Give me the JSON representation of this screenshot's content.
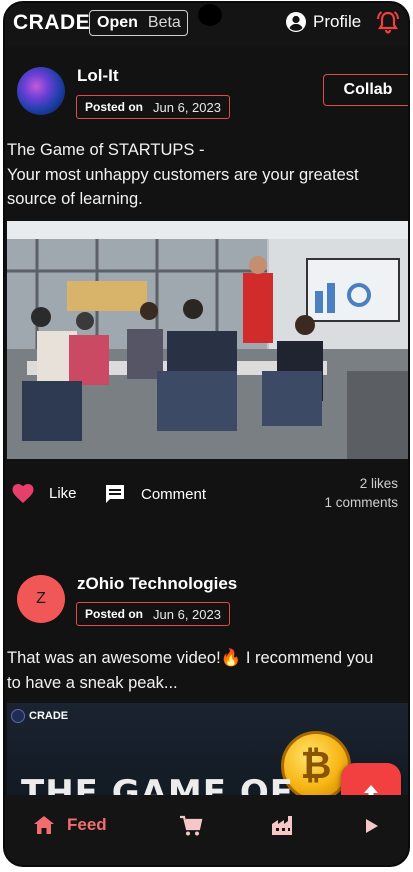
{
  "header": {
    "logo": "CRADE",
    "mode_active": "Open",
    "mode_inactive": "Beta",
    "profile_label": "Profile"
  },
  "posts": [
    {
      "author": "Lol-It",
      "posted_label": "Posted on",
      "date": "Jun 6, 2023",
      "collab_label": "Collab",
      "text_line1": "The Game of STARTUPS -",
      "text_line2": "Your most unhappy customers are your greatest",
      "text_line3": "source of learning.",
      "like_label": "Like",
      "comment_label": "Comment",
      "likes": "2 likes",
      "comments": "1 comments"
    },
    {
      "author": "zOhio Technologies",
      "avatar_letter": "Z",
      "posted_label": "Posted on",
      "date": "Jun 6, 2023",
      "text_line1": "That was an awesome video!🔥 I recommend you",
      "text_line2": "to have a sneak peak...",
      "video_logo": "CRADE",
      "video_title": "THE GAME OF"
    }
  ],
  "bottom_nav": {
    "feed_label": "Feed",
    "icons": [
      "home-icon",
      "cart-icon",
      "factory-icon",
      "play-icon"
    ]
  },
  "colors": {
    "accent": "#e04a4a",
    "background": "#141414",
    "feed_active": "#f26d6d",
    "fab": "#f23f3f"
  }
}
